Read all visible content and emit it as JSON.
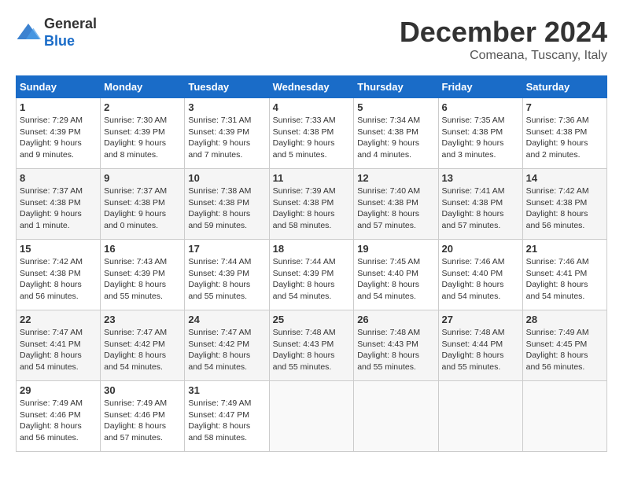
{
  "header": {
    "logo_general": "General",
    "logo_blue": "Blue",
    "month_title": "December 2024",
    "subtitle": "Comeana, Tuscany, Italy"
  },
  "calendar": {
    "weekdays": [
      "Sunday",
      "Monday",
      "Tuesday",
      "Wednesday",
      "Thursday",
      "Friday",
      "Saturday"
    ],
    "weeks": [
      [
        {
          "day": "1",
          "info": "Sunrise: 7:29 AM\nSunset: 4:39 PM\nDaylight: 9 hours and 9 minutes."
        },
        {
          "day": "2",
          "info": "Sunrise: 7:30 AM\nSunset: 4:39 PM\nDaylight: 9 hours and 8 minutes."
        },
        {
          "day": "3",
          "info": "Sunrise: 7:31 AM\nSunset: 4:39 PM\nDaylight: 9 hours and 7 minutes."
        },
        {
          "day": "4",
          "info": "Sunrise: 7:33 AM\nSunset: 4:38 PM\nDaylight: 9 hours and 5 minutes."
        },
        {
          "day": "5",
          "info": "Sunrise: 7:34 AM\nSunset: 4:38 PM\nDaylight: 9 hours and 4 minutes."
        },
        {
          "day": "6",
          "info": "Sunrise: 7:35 AM\nSunset: 4:38 PM\nDaylight: 9 hours and 3 minutes."
        },
        {
          "day": "7",
          "info": "Sunrise: 7:36 AM\nSunset: 4:38 PM\nDaylight: 9 hours and 2 minutes."
        }
      ],
      [
        {
          "day": "8",
          "info": "Sunrise: 7:37 AM\nSunset: 4:38 PM\nDaylight: 9 hours and 1 minute."
        },
        {
          "day": "9",
          "info": "Sunrise: 7:37 AM\nSunset: 4:38 PM\nDaylight: 9 hours and 0 minutes."
        },
        {
          "day": "10",
          "info": "Sunrise: 7:38 AM\nSunset: 4:38 PM\nDaylight: 8 hours and 59 minutes."
        },
        {
          "day": "11",
          "info": "Sunrise: 7:39 AM\nSunset: 4:38 PM\nDaylight: 8 hours and 58 minutes."
        },
        {
          "day": "12",
          "info": "Sunrise: 7:40 AM\nSunset: 4:38 PM\nDaylight: 8 hours and 57 minutes."
        },
        {
          "day": "13",
          "info": "Sunrise: 7:41 AM\nSunset: 4:38 PM\nDaylight: 8 hours and 57 minutes."
        },
        {
          "day": "14",
          "info": "Sunrise: 7:42 AM\nSunset: 4:38 PM\nDaylight: 8 hours and 56 minutes."
        }
      ],
      [
        {
          "day": "15",
          "info": "Sunrise: 7:42 AM\nSunset: 4:38 PM\nDaylight: 8 hours and 56 minutes."
        },
        {
          "day": "16",
          "info": "Sunrise: 7:43 AM\nSunset: 4:39 PM\nDaylight: 8 hours and 55 minutes."
        },
        {
          "day": "17",
          "info": "Sunrise: 7:44 AM\nSunset: 4:39 PM\nDaylight: 8 hours and 55 minutes."
        },
        {
          "day": "18",
          "info": "Sunrise: 7:44 AM\nSunset: 4:39 PM\nDaylight: 8 hours and 54 minutes."
        },
        {
          "day": "19",
          "info": "Sunrise: 7:45 AM\nSunset: 4:40 PM\nDaylight: 8 hours and 54 minutes."
        },
        {
          "day": "20",
          "info": "Sunrise: 7:46 AM\nSunset: 4:40 PM\nDaylight: 8 hours and 54 minutes."
        },
        {
          "day": "21",
          "info": "Sunrise: 7:46 AM\nSunset: 4:41 PM\nDaylight: 8 hours and 54 minutes."
        }
      ],
      [
        {
          "day": "22",
          "info": "Sunrise: 7:47 AM\nSunset: 4:41 PM\nDaylight: 8 hours and 54 minutes."
        },
        {
          "day": "23",
          "info": "Sunrise: 7:47 AM\nSunset: 4:42 PM\nDaylight: 8 hours and 54 minutes."
        },
        {
          "day": "24",
          "info": "Sunrise: 7:47 AM\nSunset: 4:42 PM\nDaylight: 8 hours and 54 minutes."
        },
        {
          "day": "25",
          "info": "Sunrise: 7:48 AM\nSunset: 4:43 PM\nDaylight: 8 hours and 55 minutes."
        },
        {
          "day": "26",
          "info": "Sunrise: 7:48 AM\nSunset: 4:43 PM\nDaylight: 8 hours and 55 minutes."
        },
        {
          "day": "27",
          "info": "Sunrise: 7:48 AM\nSunset: 4:44 PM\nDaylight: 8 hours and 55 minutes."
        },
        {
          "day": "28",
          "info": "Sunrise: 7:49 AM\nSunset: 4:45 PM\nDaylight: 8 hours and 56 minutes."
        }
      ],
      [
        {
          "day": "29",
          "info": "Sunrise: 7:49 AM\nSunset: 4:46 PM\nDaylight: 8 hours and 56 minutes."
        },
        {
          "day": "30",
          "info": "Sunrise: 7:49 AM\nSunset: 4:46 PM\nDaylight: 8 hours and 57 minutes."
        },
        {
          "day": "31",
          "info": "Sunrise: 7:49 AM\nSunset: 4:47 PM\nDaylight: 8 hours and 58 minutes."
        },
        null,
        null,
        null,
        null
      ]
    ]
  }
}
